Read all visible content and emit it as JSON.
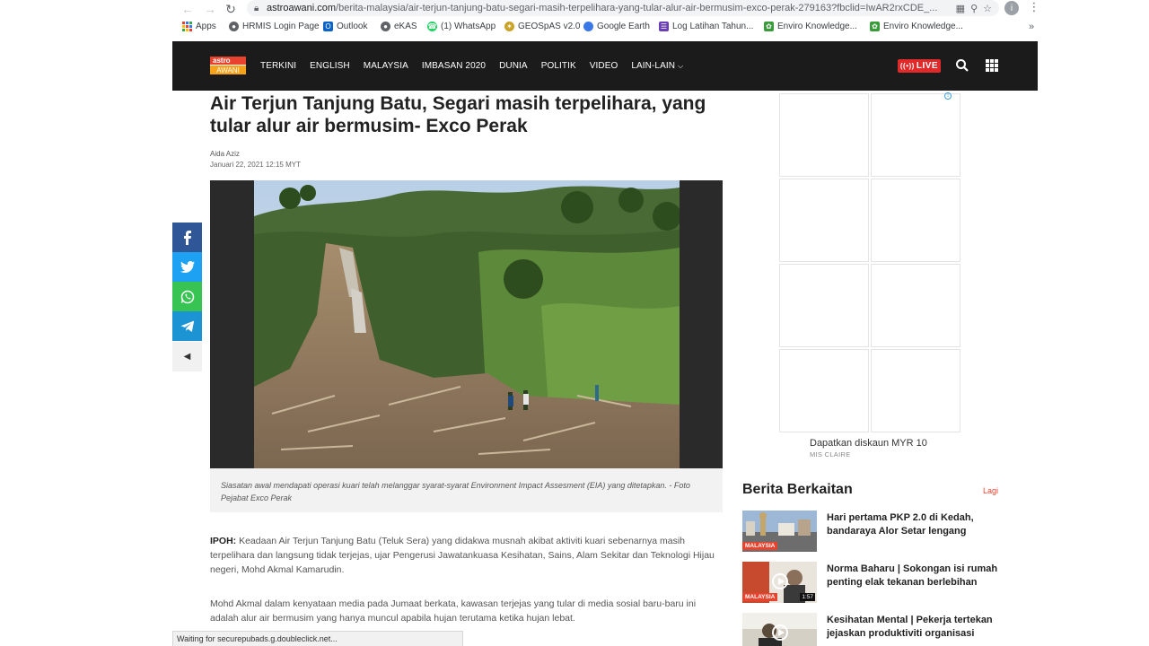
{
  "browser": {
    "url_host": "astroawani.com",
    "url_path": "/berita-malaysia/air-terjun-tanjung-batu-segari-masih-terpelihara-yang-tular-alur-air-bermusim-exco-perak-279163?fbclid=IwAR2rxCDE_...",
    "profile_initial": "i",
    "bookmarks": [
      {
        "label": "Apps",
        "icon": "apps-grid-icon",
        "color": "#e8432e"
      },
      {
        "label": "HRMIS Login Page",
        "icon": "globe-icon",
        "color": "#5f6368"
      },
      {
        "label": "Outlook",
        "icon": "outlook-icon",
        "color": "#0a64c8"
      },
      {
        "label": "eKAS",
        "icon": "globe-icon",
        "color": "#5f6368"
      },
      {
        "label": "(1) WhatsApp",
        "icon": "whatsapp-icon",
        "color": "#25d366"
      },
      {
        "label": "GEOSpAS v2.0",
        "icon": "geospas-icon",
        "color": "#c9a227"
      },
      {
        "label": "Google Earth",
        "icon": "google-earth-icon",
        "color": "#3b78e7"
      },
      {
        "label": "Log Latihan Tahun...",
        "icon": "form-icon",
        "color": "#6a3fb5"
      },
      {
        "label": "Enviro Knowledge...",
        "icon": "enviro-icon",
        "color": "#3a9b3a"
      },
      {
        "label": "Enviro Knowledge...",
        "icon": "enviro-icon",
        "color": "#3a9b3a"
      }
    ],
    "bookmarks_more": "»",
    "status_text": "Waiting for securepubads.g.doubleclick.net..."
  },
  "site": {
    "logo_top": "astro",
    "logo_bottom": "AWANI",
    "nav": [
      "TERKINI",
      "ENGLISH",
      "MALAYSIA",
      "IMBASAN 2020",
      "DUNIA",
      "POLITIK",
      "VIDEO",
      "LAIN-LAIN"
    ],
    "live_label": "LIVE",
    "colors": {
      "header_bg": "#1b1b1b",
      "accent": "#e8432e",
      "live": "#e02a2a"
    }
  },
  "article": {
    "title": "Air Terjun Tanjung Batu, Segari masih terpelihara, yang tular alur air bermusim- Exco Perak",
    "author": "Aida Aziz",
    "date": "Januari 22, 2021 12:15 MYT",
    "caption": "Siasatan awal mendapati operasi kuari telah melanggar syarat-syarat Environment Impact Assesment (EIA) yang ditetapkan. - Foto Pejabat Exco Perak",
    "para1_lead": "IPOH:",
    "para1_body": " Keadaan Air Terjun Tanjung Batu (Teluk Sera) yang didakwa musnah akibat aktiviti kuari sebenarnya masih terpelihara dan langsung tidak terjejas, ujar Pengerusi Jawatankuasa Kesihatan, Sains, Alam Sekitar dan Teknologi Hijau negeri, Mohd Akmal Kamarudin.",
    "para2": "Mohd Akmal dalam kenyataan media pada Jumaat berkata, kawasan terjejas yang tular di media sosial baru-baru ini adalah alur air bermusim yang hanya muncul apabila hujan terutama ketika hujan lebat."
  },
  "social": [
    "facebook-icon",
    "twitter-icon",
    "whatsapp-icon",
    "telegram-icon"
  ],
  "ad": {
    "headline": "Dapatkan diskaun MYR 10",
    "sponsor": "MIS CLAIRE",
    "adchoice": "i"
  },
  "related": {
    "heading": "Berita Berkaitan",
    "more": "Lagi",
    "items": [
      {
        "title": "Hari pertama PKP 2.0 di Kedah, bandaraya Alor Setar lengang",
        "tag": "MALAYSIA",
        "duration": ""
      },
      {
        "title": "Norma Baharu | Sokongan isi rumah penting elak tekanan berlebihan",
        "tag": "MALAYSIA",
        "duration": "1:57"
      },
      {
        "title": "Kesihatan Mental | Pekerja tertekan jejaskan produktiviti organisasi",
        "tag": "",
        "duration": ""
      }
    ]
  }
}
